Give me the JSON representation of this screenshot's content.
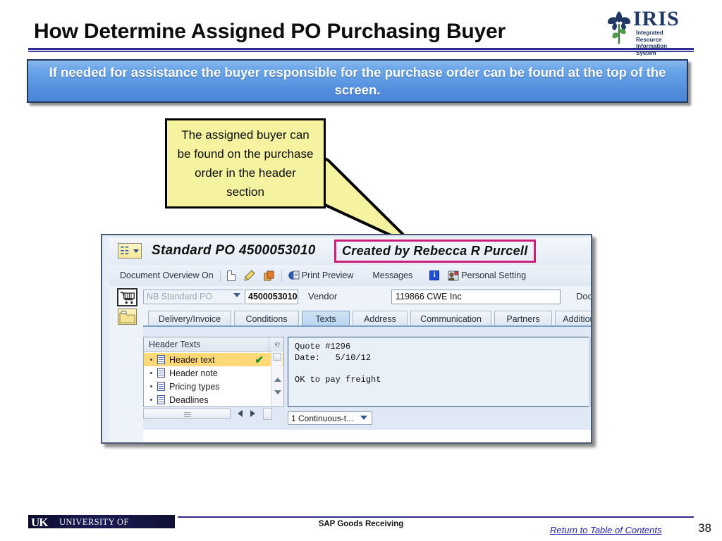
{
  "slide": {
    "title": "How Determine Assigned PO Purchasing Buyer",
    "banner_text": "If needed for assistance the buyer responsible for the purchase order can be found at the top of the screen.",
    "callout_text": "The assigned buyer can be found on the purchase order in the header section",
    "accent_blue": "#2d2d8f",
    "banner_blue": "#5a97e0",
    "callout_yellow": "#f5f2a0",
    "highlight_magenta": "#cc1f7a"
  },
  "logo": {
    "name": "IRIS",
    "subtitle_line1": "Integrated Resource",
    "subtitle_line2": "Information System",
    "icon": "iris-flower-icon"
  },
  "sap": {
    "app_icon": "sap-document-icon",
    "title": "Standard PO 4500053010",
    "created_by": "Created by Rebecca R Purcell",
    "toolbar": [
      {
        "label": "Document Overview On",
        "icon": ""
      },
      {
        "label": "",
        "icon": "new-document-icon"
      },
      {
        "label": "",
        "icon": "pencil-icon"
      },
      {
        "label": "",
        "icon": "copy-icon"
      },
      {
        "label": "Print Preview",
        "icon": "print-preview-icon"
      },
      {
        "label": "Messages",
        "icon": ""
      },
      {
        "label": "",
        "icon": "info-icon"
      },
      {
        "label": "Personal Setting",
        "icon": "personal-setting-icon"
      }
    ],
    "header_row": {
      "cart_icon": "shopping-cart-icon",
      "doc_type": "NB Standard PO",
      "po_number": "4500053010",
      "vendor_label": "Vendor",
      "vendor_value": "119866 CWE Inc",
      "doc_date_label": "Doc. date"
    },
    "tabs": [
      {
        "label": "Delivery/Invoice",
        "active": false
      },
      {
        "label": "Conditions",
        "active": false
      },
      {
        "label": "Texts",
        "active": true
      },
      {
        "label": "Address",
        "active": false
      },
      {
        "label": "Communication",
        "active": false
      },
      {
        "label": "Partners",
        "active": false
      },
      {
        "label": "Additional D",
        "active": false
      }
    ],
    "texts_panel": {
      "column_header": "Header Texts",
      "sort_icon": "sort-icon",
      "rows": [
        {
          "label": "Header text",
          "selected": true,
          "check": "✔"
        },
        {
          "label": "Header note",
          "selected": false,
          "check": ""
        },
        {
          "label": "Pricing types",
          "selected": false,
          "check": ""
        },
        {
          "label": "Deadlines",
          "selected": false,
          "check": ""
        }
      ]
    },
    "text_content": "Quote #1296\nDate:   5/10/12\n\nOK to pay freight",
    "format_select": "1 Continuous-t..."
  },
  "footer": {
    "university": "UNIVERSITY OF KENTUCKY",
    "uk_mark": "UK",
    "center_text": "SAP Goods Receiving",
    "link_text": "Return to Table of Contents",
    "page_number": "38"
  }
}
